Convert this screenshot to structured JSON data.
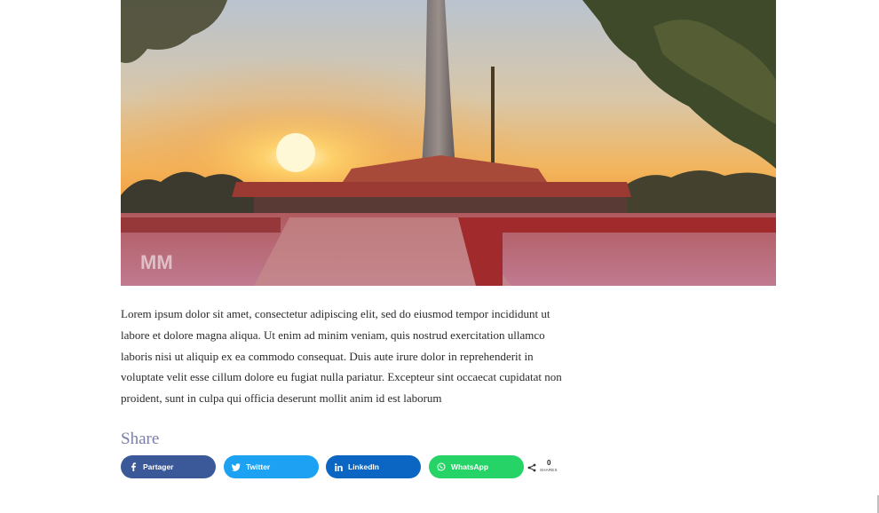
{
  "article": {
    "image_alt": "Sunset at monument plaza",
    "watermark": "MM",
    "paragraph": "Lorem ipsum dolor sit amet, consectetur adipiscing elit, sed do eiusmod tempor incididunt ut labore et dolore magna aliqua. Ut enim ad minim veniam, quis nostrud exercitation ullamco laboris nisi ut aliquip ex ea commodo consequat. Duis aute irure dolor in reprehenderit in voluptate velit esse cillum dolore eu fugiat nulla pariatur. Excepteur sint occaecat cupidatat non proident, sunt in culpa qui officia deserunt mollit anim id est laborum"
  },
  "share": {
    "title": "Share",
    "buttons": [
      {
        "label": "Partager",
        "icon": "facebook-icon",
        "color": "#3b5998"
      },
      {
        "label": "Twitter",
        "icon": "twitter-icon",
        "color": "#1da1f2"
      },
      {
        "label": "LinkedIn",
        "icon": "linkedin-icon",
        "color": "#0a66c2"
      },
      {
        "label": "WhatsApp",
        "icon": "whatsapp-icon",
        "color": "#25d366"
      }
    ],
    "count": "0",
    "count_label": "SHARES"
  }
}
